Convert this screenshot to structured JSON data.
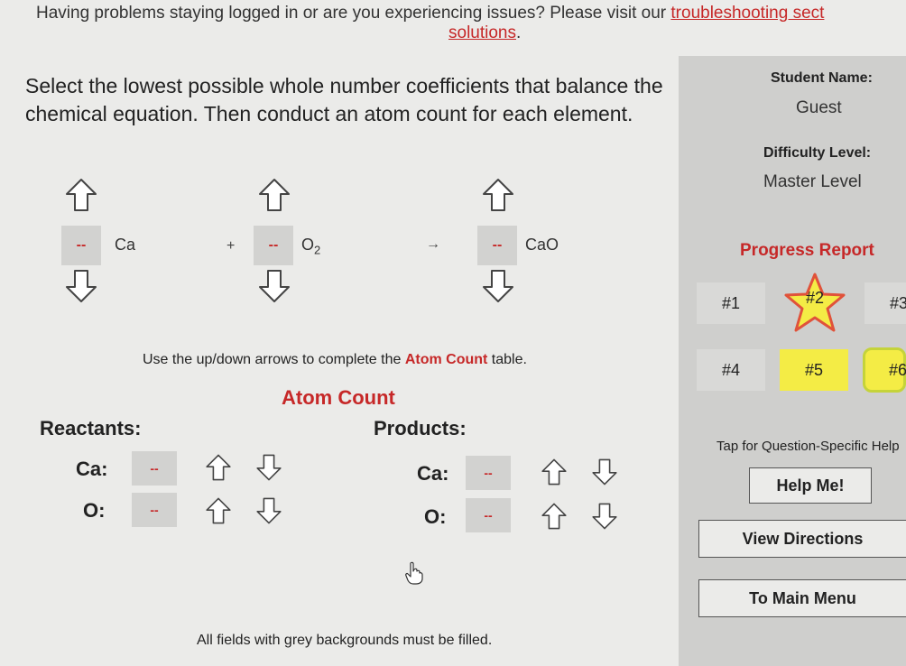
{
  "banner": {
    "text_before": "Having problems staying logged in or are you experiencing issues? Please visit our ",
    "link_text": "troubleshooting sect",
    "link_line2": "solutions",
    "text_after": "."
  },
  "instructions": "Select the lowest possible whole number coefficients that balance the chemical equation. Then conduct an atom count for each element.",
  "equation": {
    "terms": [
      {
        "coefficient": "--",
        "formula": "Ca"
      },
      {
        "coefficient": "--",
        "formula": "O",
        "subscript": "2"
      },
      {
        "coefficient": "--",
        "formula": "CaO"
      }
    ],
    "plus": "+",
    "arrow": "→"
  },
  "hint": {
    "before": "Use the up/down arrows to complete the ",
    "emphasis": "Atom Count",
    "after": " table."
  },
  "atom_count": {
    "title": "Atom Count",
    "reactants_label": "Reactants:",
    "products_label": "Products:",
    "reactants": [
      {
        "element": "Ca:",
        "value": "--"
      },
      {
        "element": "O:",
        "value": "--"
      }
    ],
    "products": [
      {
        "element": "Ca:",
        "value": "--"
      },
      {
        "element": "O:",
        "value": "--"
      }
    ]
  },
  "footer_note": "All fields with grey backgrounds must be filled.",
  "sidebar": {
    "student_name_label": "Student Name:",
    "student_name": "Guest",
    "difficulty_label": "Difficulty Level:",
    "difficulty": "Master Level",
    "progress_title": "Progress Report",
    "questions": [
      {
        "label": "#1",
        "state": "plain"
      },
      {
        "label": "#2",
        "state": "current"
      },
      {
        "label": "#3",
        "state": "plain"
      },
      {
        "label": "#4",
        "state": "plain"
      },
      {
        "label": "#5",
        "state": "yellow"
      },
      {
        "label": "#6",
        "state": "outlined"
      }
    ],
    "help_text": "Tap for Question-Specific Help",
    "help_button": "Help Me!",
    "directions_button": "View Directions",
    "main_menu_button": "To Main Menu"
  },
  "colors": {
    "accent_red": "#c62828",
    "tile_yellow": "#f4ec45",
    "sidebar_bg": "#cfcfcd",
    "input_grey": "#d2d2d0"
  }
}
